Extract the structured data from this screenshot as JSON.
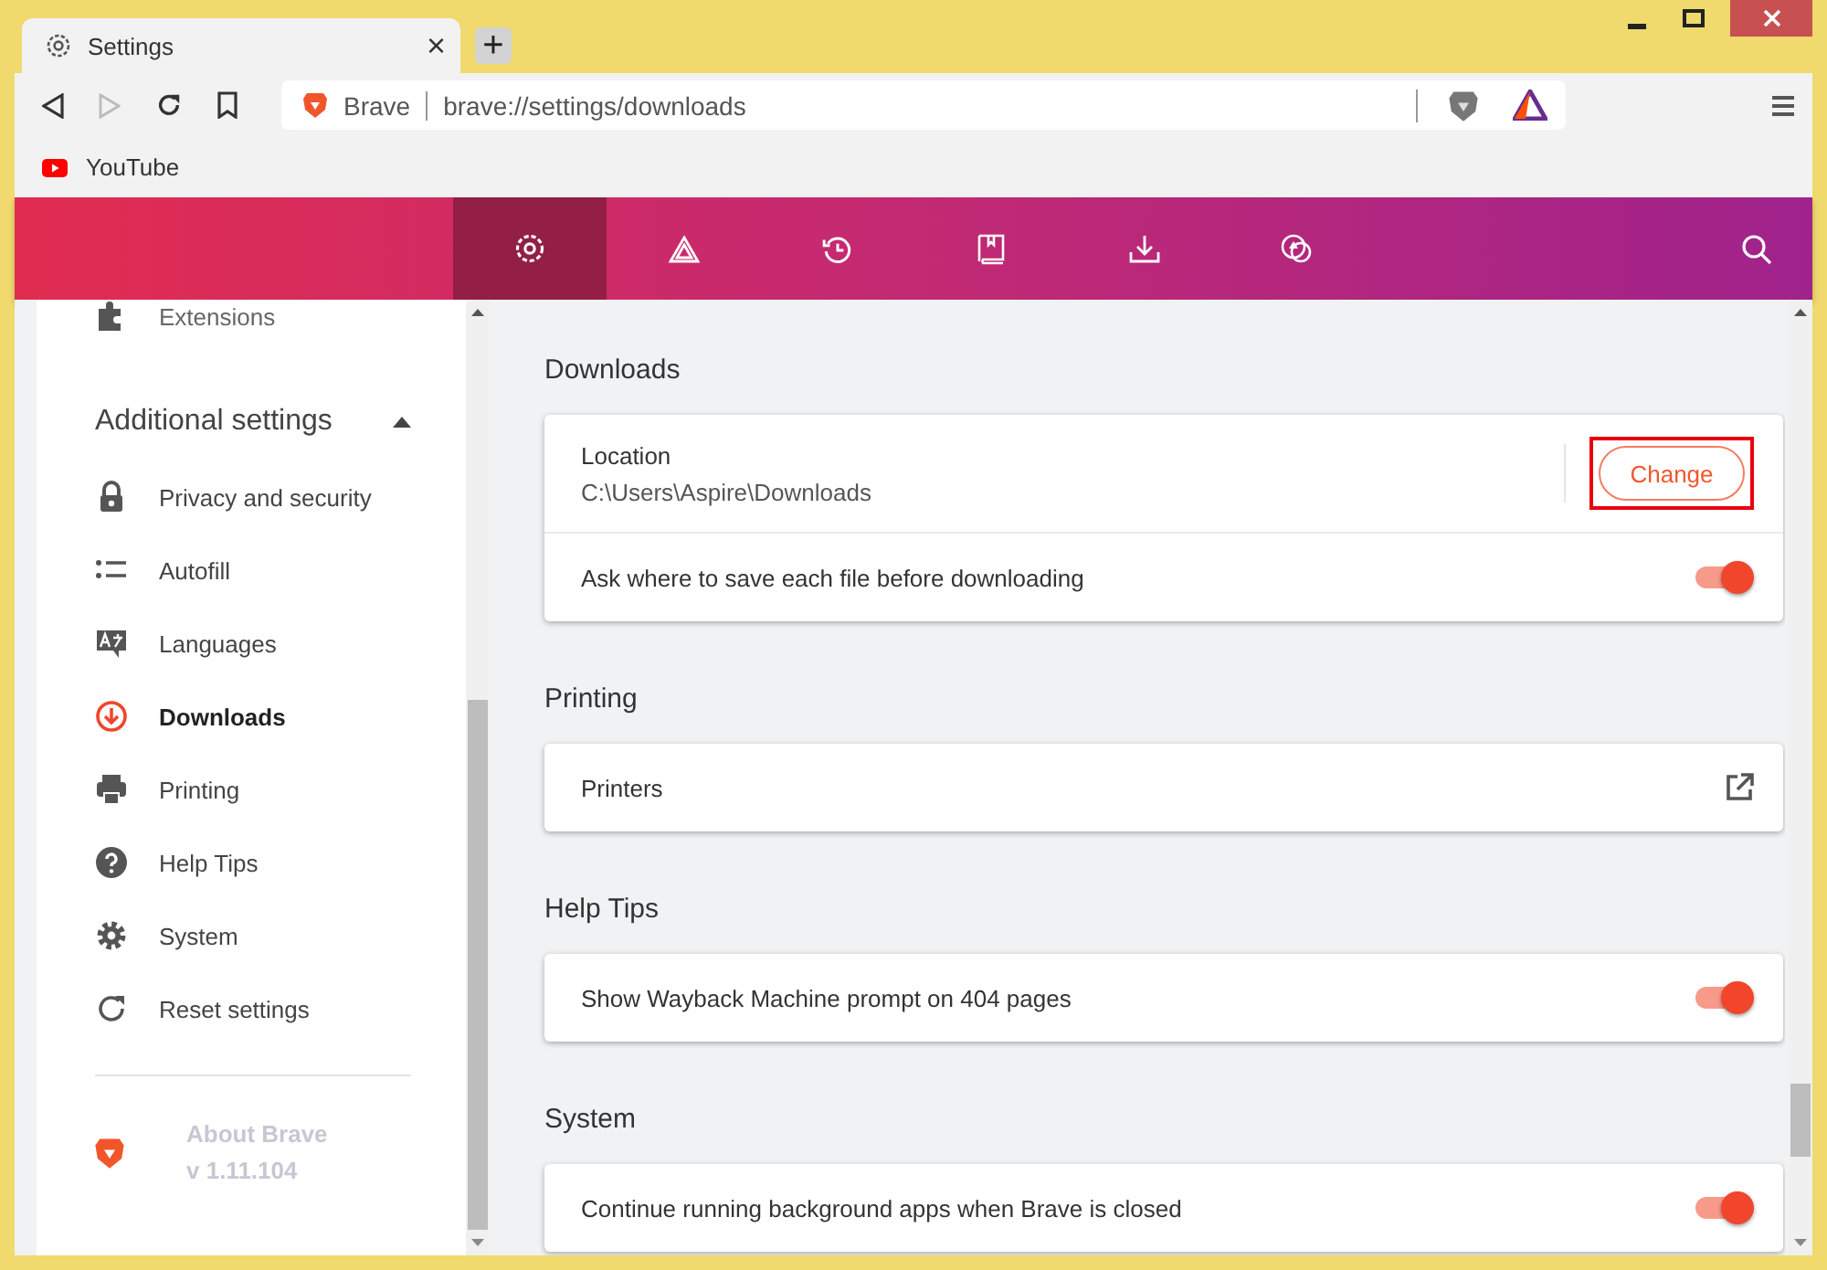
{
  "tab": {
    "title": "Settings",
    "close": "×"
  },
  "new_tab": "+",
  "address_bar": {
    "site_label": "Brave",
    "url": "brave://settings/downloads"
  },
  "bookmarks": [
    {
      "label": "YouTube"
    }
  ],
  "nav": [
    {
      "selected": true
    },
    {
      "selected": false
    },
    {
      "selected": false
    },
    {
      "selected": false
    },
    {
      "selected": false
    },
    {
      "selected": false
    }
  ],
  "sidebar": {
    "cut_item": "Extensions",
    "section": {
      "title": "Additional settings",
      "expanded": true
    },
    "items": [
      {
        "label": "Privacy and security",
        "selected": false
      },
      {
        "label": "Autofill",
        "selected": false
      },
      {
        "label": "Languages",
        "selected": false
      },
      {
        "label": "Downloads",
        "selected": true
      },
      {
        "label": "Printing",
        "selected": false
      },
      {
        "label": "Help Tips",
        "selected": false
      },
      {
        "label": "System",
        "selected": false
      },
      {
        "label": "Reset settings",
        "selected": false
      }
    ],
    "about": {
      "title": "About Brave",
      "version": "v 1.11.104"
    }
  },
  "sections": [
    {
      "title": "Downloads",
      "rows": [
        {
          "kind": "location",
          "label": "Location",
          "value": "C:\\Users\\Aspire\\Downloads",
          "button": "Change",
          "highlighted": true
        },
        {
          "kind": "toggle",
          "label": "Ask where to save each file before downloading",
          "on": true
        }
      ]
    },
    {
      "title": "Printing",
      "rows": [
        {
          "kind": "link",
          "label": "Printers"
        }
      ]
    },
    {
      "title": "Help Tips",
      "rows": [
        {
          "kind": "toggle",
          "label": "Show Wayback Machine prompt on 404 pages",
          "on": true
        }
      ]
    },
    {
      "title": "System",
      "rows": [
        {
          "kind": "toggle",
          "label": "Continue running background apps when Brave is closed",
          "on": true
        }
      ]
    }
  ]
}
